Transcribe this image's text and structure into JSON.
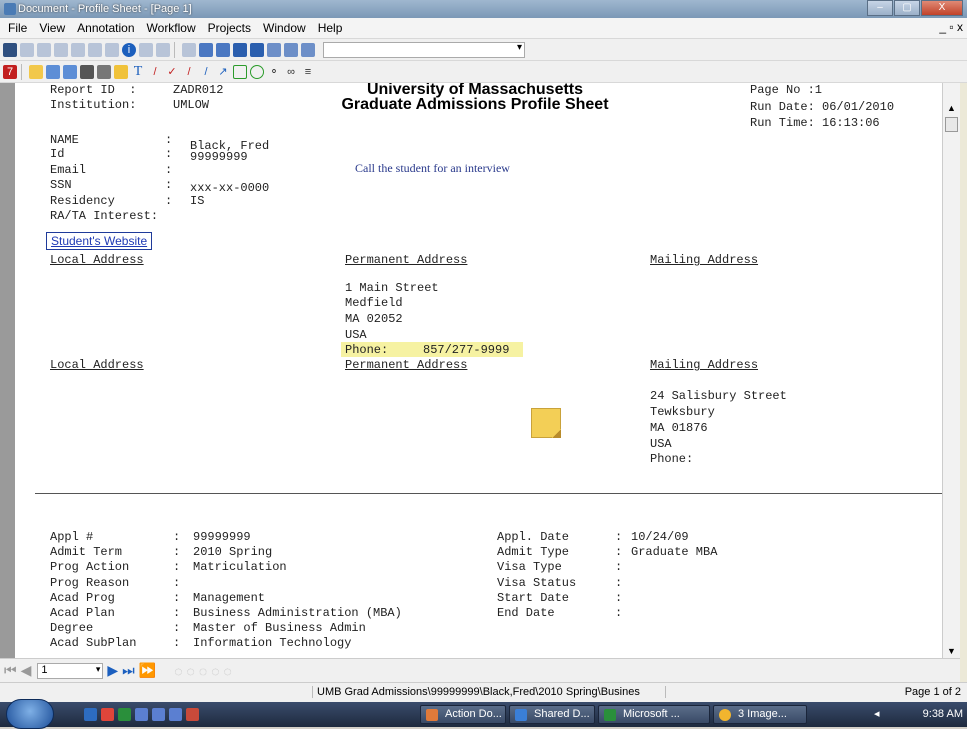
{
  "window": {
    "title": "Document - Profile Sheet - [Page 1]",
    "controls": [
      "–",
      "▢",
      "X"
    ]
  },
  "menu": {
    "items": [
      "File",
      "View",
      "Annotation",
      "Workflow",
      "Projects",
      "Window",
      "Help"
    ],
    "right": "_ ▫ x"
  },
  "doc": {
    "report_id_label": "Report ID  :",
    "report_id": "ZADR012",
    "institution_label": "Institution:",
    "institution": "UMLOW",
    "title1": "University of Massachusetts",
    "title2": "Graduate Admissions Profile Sheet",
    "page_no": "Page No :1",
    "run_date": "Run Date: 06/01/2010",
    "run_time": "Run Time: 16:13:06",
    "fields": [
      {
        "label": "NAME",
        "value": "Black, Fred"
      },
      {
        "label": "Id",
        "value": "99999999"
      },
      {
        "label": "Email",
        "value": ""
      },
      {
        "label": "SSN",
        "value": "xxx-xx-0000"
      },
      {
        "label": "Residency",
        "value": "IS"
      }
    ],
    "ra_ta": "RA/TA Interest:",
    "note": "Call the student for an interview",
    "website_link": "Student's Website",
    "addr1": {
      "local": "Local Address",
      "permanent": "Permanent Address",
      "mailing": "Mailing Address",
      "perm_lines": [
        "1 Main Street",
        "Medfield",
        "MA 02052",
        "USA"
      ],
      "phone_label": "Phone:",
      "phone": "857/277-9999"
    },
    "addr2": {
      "local": "Local Address",
      "permanent": "Permanent Address",
      "mailing": "Mailing Address",
      "mail_lines": [
        "24 Salisbury Street",
        "Tewksbury",
        "MA 01876",
        "USA",
        "Phone:"
      ]
    },
    "appl_left": [
      {
        "label": "Appl #",
        "value": "99999999"
      },
      {
        "label": "Admit Term",
        "value": "2010 Spring"
      },
      {
        "label": "Prog Action",
        "value": "Matriculation"
      },
      {
        "label": "Prog Reason",
        "value": ""
      },
      {
        "label": "Acad Prog",
        "value": "Management"
      },
      {
        "label": "Acad Plan",
        "value": "Business Administration (MBA)"
      },
      {
        "label": "Degree",
        "value": "Master of Business Admin"
      },
      {
        "label": "Acad SubPlan",
        "value": "Information Technology"
      }
    ],
    "appl_right": [
      {
        "label": "Appl. Date",
        "value": "10/24/09"
      },
      {
        "label": "Admit Type",
        "value": "Graduate MBA"
      },
      {
        "label": "Visa Type",
        "value": ""
      },
      {
        "label": "Visa Status",
        "value": ""
      },
      {
        "label": "Start Date",
        "value": ""
      },
      {
        "label": "End Date",
        "value": ""
      }
    ]
  },
  "nav": {
    "page_value": "1"
  },
  "status": {
    "path": "UMB Grad Admissions\\99999999\\Black,Fred\\2010 Spring\\Busines",
    "page_of": "Page 1 of 2"
  },
  "taskbar": {
    "tasks": [
      "Action Do...",
      "Shared D...",
      "Microsoft ...",
      "3 Image..."
    ],
    "clock": "9:38 AM"
  },
  "colors": {
    "highlight": "#f6f2a2",
    "note_text": "#2a3a8c",
    "link": "#1f3ab4"
  }
}
